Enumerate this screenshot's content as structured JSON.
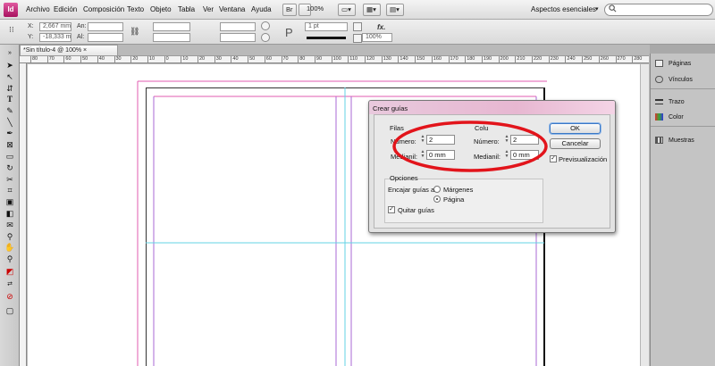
{
  "app": {
    "logo_text": "Id"
  },
  "menubar": {
    "items": [
      "Archivo",
      "Edición",
      "Composición",
      "Texto",
      "Objeto",
      "Tabla",
      "Ver",
      "Ventana",
      "Ayuda"
    ],
    "bridge_label": "Br",
    "zoom": "100%",
    "workspace": "Aspectos esenciales"
  },
  "control_panel": {
    "x_label": "X:",
    "x_value": "2,667 mm",
    "y_label": "Y:",
    "y_value": "-18,333 mm",
    "w_label": "An:",
    "h_label": "Al:",
    "stroke_weight": "1 pt",
    "percent": "100%",
    "fx_label": "fx."
  },
  "document_tab": {
    "title": "*Sin título-4 @ 100%",
    "close": "×"
  },
  "ruler": {
    "labels": [
      "80",
      "70",
      "60",
      "50",
      "40",
      "30",
      "20",
      "10",
      "0",
      "10",
      "20",
      "30",
      "40",
      "50",
      "60",
      "70",
      "80",
      "90",
      "100",
      "110",
      "120",
      "130",
      "140",
      "150",
      "160",
      "170",
      "180",
      "190",
      "200",
      "210",
      "220",
      "230",
      "240",
      "250",
      "260",
      "270",
      "280",
      "290"
    ]
  },
  "panels": [
    {
      "label": "Páginas",
      "icon": "pages-icon"
    },
    {
      "label": "Vínculos",
      "icon": "links-icon"
    },
    {
      "label": "Trazo",
      "icon": "stroke-icon"
    },
    {
      "label": "Color",
      "icon": "color-icon"
    },
    {
      "label": "Muestras",
      "icon": "swatches-icon"
    }
  ],
  "dialog": {
    "title": "Crear guías",
    "filas": {
      "heading": "Filas",
      "numero_label": "Número:",
      "numero_value": "2",
      "medianil_label": "Medianil:",
      "medianil_value": "0 mm"
    },
    "columnas": {
      "heading": "Colu",
      "numero_label": "Número:",
      "numero_value": "2",
      "medianil_label": "Medianil:",
      "medianil_value": "0 mm"
    },
    "opciones": {
      "heading": "Opciones",
      "encajar_label": "Encajar guías a:",
      "options": [
        "Márgenes",
        "Página"
      ],
      "selected": "Página",
      "quitar_label": "Quitar guías",
      "quitar_checked": true
    },
    "ok_label": "OK",
    "cancel_label": "Cancelar",
    "preview_label": "Previsualización",
    "preview_checked": true
  },
  "colors": {
    "margin_guide": "#e25bb1",
    "column_guide": "#a86ad6",
    "ruler_guide": "#63d3e6",
    "annotation_ellipse": "#e2141b",
    "dialog_title": "#e7b7d1"
  }
}
